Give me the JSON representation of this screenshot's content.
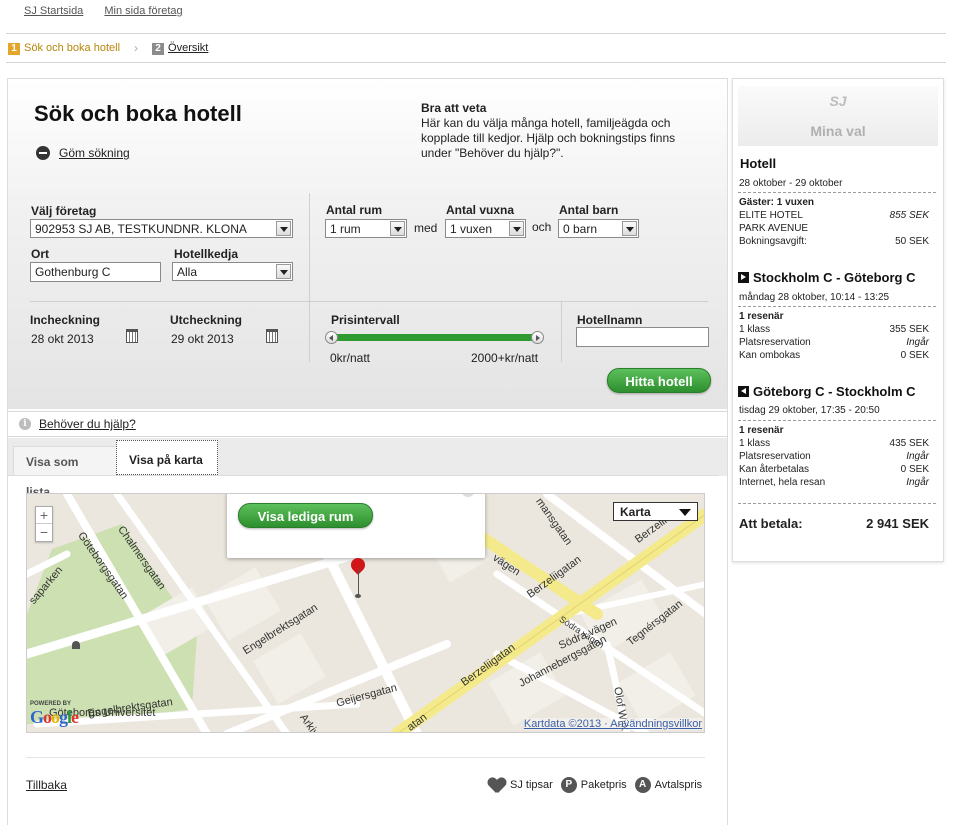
{
  "topnav": {
    "home": "SJ Startsida",
    "mypage": "Min sida företag"
  },
  "steps": [
    {
      "num": "1",
      "label": "Sök och boka hotell"
    },
    {
      "num": "2",
      "label": "Översikt"
    }
  ],
  "page": {
    "title": "Sök och boka hotell",
    "hide_search": "Göm sökning",
    "tips_title": "Bra att veta",
    "tips_text": "Här kan du välja många hotell, familjeägda och kopplade till kedjor. Hjälp och bokningstips finns under \"Behöver du hjälp?\"."
  },
  "form": {
    "company_label": "Välj företag",
    "company_value": "902953 SJ AB, TESTKUNDNR. KLONA",
    "city_label": "Ort",
    "city_value": "Gothenburg C",
    "chain_label": "Hotellkedja",
    "chain_value": "Alla",
    "rooms_label": "Antal rum",
    "rooms_value": "1 rum",
    "with_text": "med",
    "adults_label": "Antal vuxna",
    "adults_value": "1 vuxen",
    "and_text": "och",
    "children_label": "Antal barn",
    "children_value": "0 barn",
    "checkin_label": "Incheckning",
    "checkin_value": "28 okt 2013",
    "checkout_label": "Utcheckning",
    "checkout_value": "29 okt 2013",
    "price_label": "Prisintervall",
    "price_min": "0kr/natt",
    "price_max": "2000+kr/natt",
    "price_range_fraction": [
      0.0,
      1.0
    ],
    "hotelname_label": "Hotellnamn",
    "hotelname_value": "",
    "find_button": "Hitta hotell"
  },
  "help": {
    "label": "Behöver du hjälp?"
  },
  "tabs": {
    "list": "Visa som lista",
    "map": "Visa på karta"
  },
  "map": {
    "zoom_in": "+",
    "zoom_out": "−",
    "type_select": "Karta",
    "show_rooms_button": "Visa lediga rum",
    "credit": "Kartdata ©2013 · Användningsvillkor",
    "powered": "POWERED BY",
    "google": "Google",
    "labels": {
      "chalmersgatan": "Chalmersgatan",
      "goteborgsgatan": "Göteborgsgatan",
      "saparken": "saparken",
      "engelbrektsgatan": "Engelbrektsgatan",
      "engelbrektsgatan2": "Engelbrektsgatan",
      "univ": "Göteborgs Universitet",
      "geijersgatan": "Geijersgatan",
      "arkiv": "Arkiv",
      "berzeliigatan": "Berzeliigatan",
      "berzeliigatan2": "Berzeliigatan",
      "berzelii": "Berzelii",
      "vagen": "vägen",
      "sodra_vagen": "Södra vägen",
      "sodra_vagen2": "Södra vägen",
      "johannebergsgatan": "Johannebergsgatan",
      "tegnersgatan": "Tegnérsgatan",
      "olof": "Olof Wijk",
      "mansgatan": "mansgatan",
      "atan": "atan"
    }
  },
  "footer": {
    "back": "Tillbaka",
    "legend": [
      {
        "key": "heart",
        "label": "SJ tipsar"
      },
      {
        "key": "P",
        "label": "Paketpris"
      },
      {
        "key": "A",
        "label": "Avtalspris"
      }
    ]
  },
  "sidebar": {
    "title": "Mina val",
    "logo": "SJ",
    "hotel": {
      "heading": "Hotell",
      "dates": "28 oktober - 29 oktober",
      "guests": "Gäster: 1 vuxen",
      "name1": "ELITE HOTEL",
      "name2": "PARK AVENUE",
      "price": "855 SEK",
      "fee_label": "Bokningsavgift:",
      "fee": "50 SEK"
    },
    "trip1": {
      "heading": "Stockholm C - Göteborg C",
      "date": "måndag 28 oktober, 10:14 - 13:25",
      "travellers": "1 resenär",
      "class": "1 klass",
      "class_price": "355 SEK",
      "seat": "Platsreservation",
      "seat_val": "Ingår",
      "rebook": "Kan ombokas",
      "rebook_val": "0 SEK"
    },
    "trip2": {
      "heading": "Göteborg C - Stockholm C",
      "date": "tisdag 29 oktober, 17:35 - 20:50",
      "travellers": "1 resenär",
      "class": "1 klass",
      "class_price": "435 SEK",
      "seat": "Platsreservation",
      "seat_val": "Ingår",
      "refund": "Kan återbetalas",
      "refund_val": "0 SEK",
      "wifi": "Internet, hela resan",
      "wifi_val": "Ingår"
    },
    "total_label": "Att betala:",
    "total": "2 941 SEK"
  }
}
